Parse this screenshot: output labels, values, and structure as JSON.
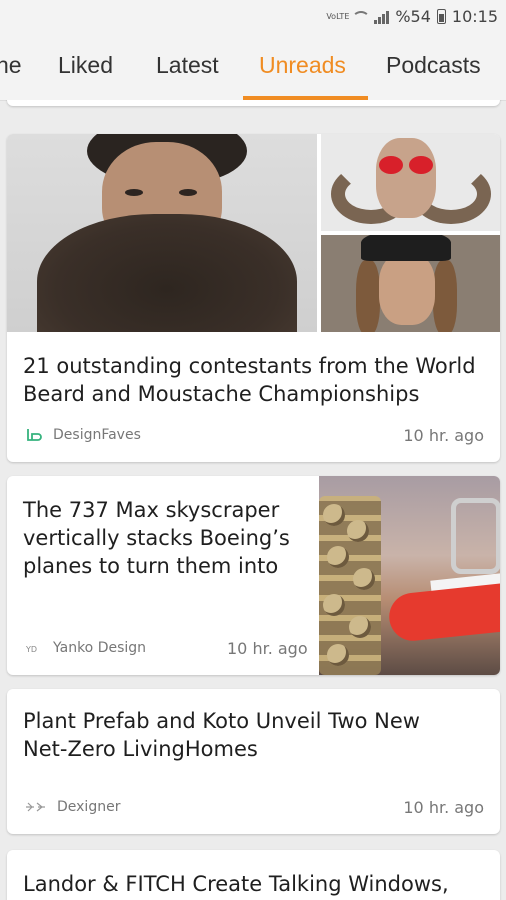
{
  "status_bar": {
    "volte": "VoLTE",
    "battery_percent": "%54",
    "time": "10:15"
  },
  "tabs": [
    {
      "label": "Home",
      "visible_label": "ne",
      "active": false
    },
    {
      "label": "Liked",
      "visible_label": "Liked",
      "active": false
    },
    {
      "label": "Latest",
      "visible_label": "Latest",
      "active": false
    },
    {
      "label": "Unreads",
      "visible_label": "Unreads",
      "active": true
    },
    {
      "label": "Podcasts",
      "visible_label": "Podcasts",
      "active": false
    }
  ],
  "accent_color": "#f08c22",
  "articles": [
    {
      "title_line1": "21 outstanding contestants from the World",
      "title_line2": "Beard and Moustache Championships",
      "source": "DesignFaves",
      "source_icon": "designfaves-icon",
      "time": "10 hr. ago"
    },
    {
      "title_line1": "The 737 Max skyscraper",
      "title_line2": "vertically stacks Boeing’s",
      "title_line3": "planes to turn them into",
      "source": "Yanko Design",
      "source_icon": "yanko-design-icon",
      "time": "10 hr. ago"
    },
    {
      "title_line1": "Plant Prefab and Koto Unveil Two New",
      "title_line2": "Net-Zero LivingHomes",
      "source": "Dexigner",
      "source_icon": "dexigner-icon",
      "time": "10 hr. ago"
    },
    {
      "title_line1": "Landor & FITCH Create Talking Windows,"
    }
  ]
}
